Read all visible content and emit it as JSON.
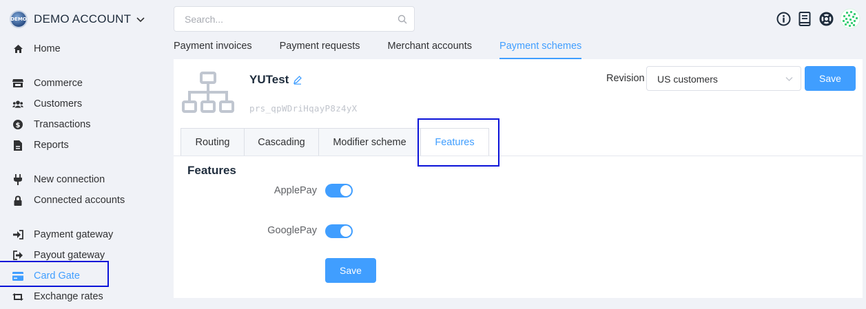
{
  "account": {
    "name": "DEMO ACCOUNT",
    "logo_text": "DEMO"
  },
  "sidebar": {
    "items": [
      {
        "label": "Home",
        "icon": "home-icon"
      },
      {
        "label": "Commerce",
        "icon": "store-icon"
      },
      {
        "label": "Customers",
        "icon": "users-icon"
      },
      {
        "label": "Transactions",
        "icon": "dollar-icon"
      },
      {
        "label": "Reports",
        "icon": "file-icon"
      },
      {
        "label": "New connection",
        "icon": "plug-icon"
      },
      {
        "label": "Connected accounts",
        "icon": "lock-icon"
      },
      {
        "label": "Payment gateway",
        "icon": "sign-in-icon"
      },
      {
        "label": "Payout gateway",
        "icon": "sign-out-icon"
      },
      {
        "label": "Card Gate",
        "icon": "credit-card-icon",
        "active": true
      },
      {
        "label": "Exchange rates",
        "icon": "retweet-icon"
      }
    ]
  },
  "search": {
    "placeholder": "Search..."
  },
  "main_tabs": [
    {
      "label": "Payment invoices"
    },
    {
      "label": "Payment requests"
    },
    {
      "label": "Merchant accounts"
    },
    {
      "label": "Payment schemes",
      "active": true
    }
  ],
  "scheme": {
    "name": "YUTest",
    "id": "prs_qpWDriHqayP8z4yX"
  },
  "revision": {
    "label": "Revision",
    "selected": "US customers"
  },
  "buttons": {
    "save": "Save"
  },
  "sub_tabs": [
    {
      "label": "Routing"
    },
    {
      "label": "Cascading"
    },
    {
      "label": "Modifier scheme"
    },
    {
      "label": "Features",
      "active": true
    }
  ],
  "features": {
    "title": "Features",
    "items": [
      {
        "label": "ApplePay",
        "enabled": true
      },
      {
        "label": "GooglePay",
        "enabled": true
      }
    ]
  },
  "colors": {
    "accent": "#409eff",
    "highlight": "#0a12d8",
    "text": "#303133"
  }
}
